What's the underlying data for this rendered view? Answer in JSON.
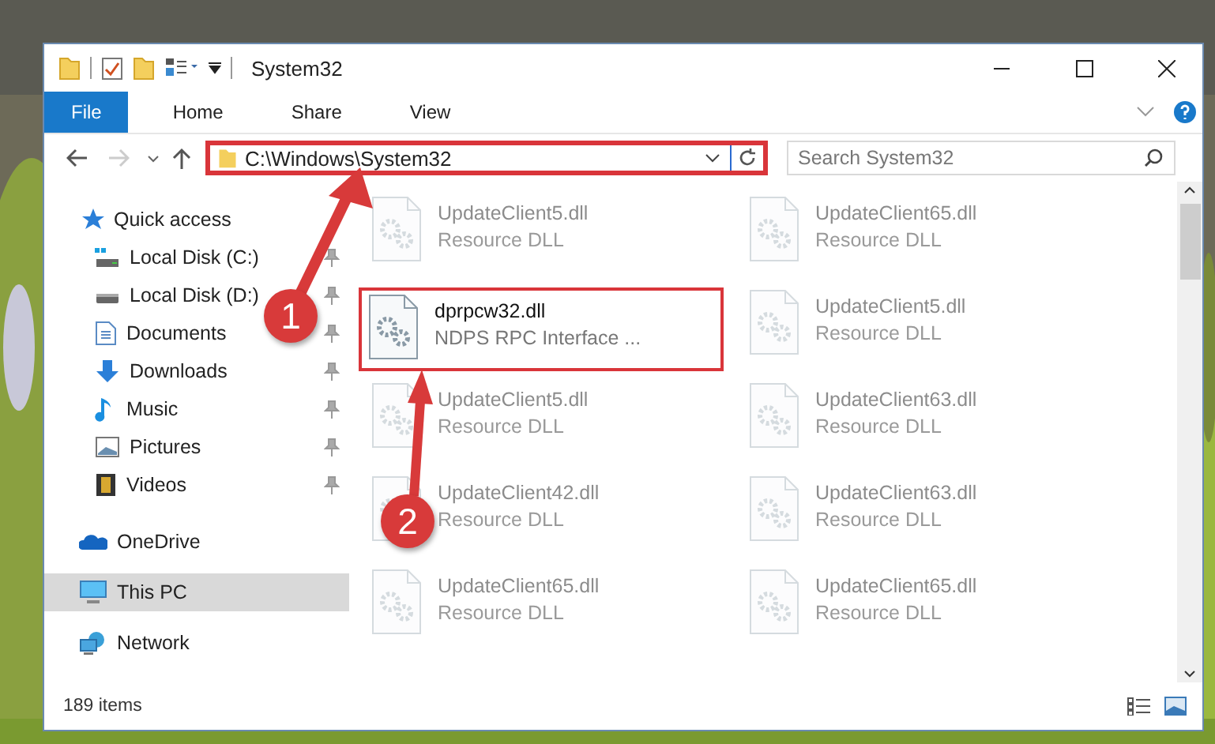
{
  "window": {
    "title": "System32"
  },
  "ribbon_tabs": [
    {
      "label": "File",
      "selected": true
    },
    {
      "label": "Home",
      "selected": false
    },
    {
      "label": "Share",
      "selected": false
    },
    {
      "label": "View",
      "selected": false
    }
  ],
  "address": {
    "value": "C:\\Windows\\System32",
    "highlighted": true
  },
  "search": {
    "placeholder": "Search System32"
  },
  "sidebar": {
    "items": [
      {
        "label": "Quick access",
        "selected": false,
        "children": [
          {
            "label": "Local Disk (C:)",
            "pinned": true
          },
          {
            "label": "Local Disk (D:)",
            "pinned": true
          },
          {
            "label": "Documents",
            "pinned": true
          },
          {
            "label": "Downloads",
            "pinned": true
          },
          {
            "label": "Music",
            "pinned": true
          },
          {
            "label": "Pictures",
            "pinned": true
          },
          {
            "label": "Videos",
            "pinned": true
          }
        ]
      },
      {
        "label": "OneDrive",
        "selected": false
      },
      {
        "label": "This PC",
        "selected": true
      },
      {
        "label": "Network",
        "selected": false
      }
    ]
  },
  "files": [
    {
      "name": "UpdateClient5.dll",
      "type": "Resource DLL",
      "faded": true,
      "highlighted": false
    },
    {
      "name": "UpdateClient65.dll",
      "type": "Resource DLL",
      "faded": true,
      "highlighted": false
    },
    {
      "name": "dprpcw32.dll",
      "type": "NDPS RPC Interface ...",
      "faded": false,
      "highlighted": true
    },
    {
      "name": "UpdateClient5.dll",
      "type": "Resource DLL",
      "faded": true,
      "highlighted": false
    },
    {
      "name": "UpdateClient5.dll",
      "type": "Resource DLL",
      "faded": true,
      "highlighted": false
    },
    {
      "name": "UpdateClient63.dll",
      "type": "Resource DLL",
      "faded": true,
      "highlighted": false
    },
    {
      "name": "UpdateClient42.dll",
      "type": "Resource DLL",
      "faded": true,
      "highlighted": false
    },
    {
      "name": "UpdateClient63.dll",
      "type": "Resource DLL",
      "faded": true,
      "highlighted": false
    },
    {
      "name": "UpdateClient65.dll",
      "type": "Resource DLL",
      "faded": true,
      "highlighted": false
    },
    {
      "name": "UpdateClient65.dll",
      "type": "Resource DLL",
      "faded": true,
      "highlighted": false
    }
  ],
  "status_bar": {
    "item_count": "189 items"
  },
  "callouts": [
    {
      "number": "1"
    },
    {
      "number": "2"
    }
  ]
}
